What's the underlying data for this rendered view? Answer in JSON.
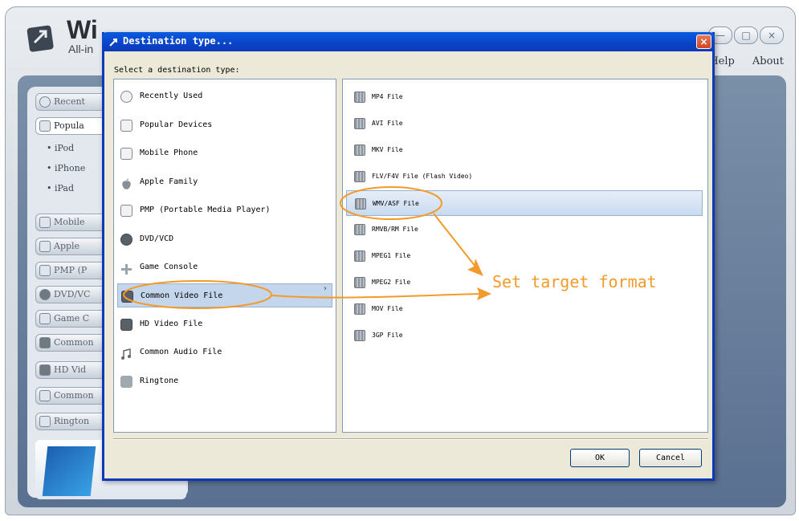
{
  "app": {
    "title": "Wi",
    "subtitle": "All-in",
    "menu": [
      "Help",
      "About"
    ],
    "window_controls": [
      "—",
      "□",
      "×"
    ],
    "sidebar_items": [
      "Recent",
      "Popula",
      "Mobile",
      "Apple",
      "PMP (P",
      "DVD/VC",
      "Game C",
      "Common",
      "HD Vid",
      "Common",
      "Rington"
    ],
    "popular_subitems": [
      "• iPod",
      "• iPhone",
      "• iPad"
    ]
  },
  "dialog": {
    "title": "Destination type...",
    "close_glyph": "×",
    "prompt": "Select a destination type:",
    "categories": [
      {
        "label": "Recently Used",
        "icon": "clock-icon"
      },
      {
        "label": "Popular Devices",
        "icon": "arrow-box-icon"
      },
      {
        "label": "Mobile Phone",
        "icon": "phone-icon"
      },
      {
        "label": "Apple Family",
        "icon": "apple-icon"
      },
      {
        "label": "PMP (Portable Media Player)",
        "icon": "player-icon"
      },
      {
        "label": "DVD/VCD",
        "icon": "disc-icon"
      },
      {
        "label": "Game Console",
        "icon": "gamepad-icon"
      },
      {
        "label": "Common Video File",
        "icon": "film-icon",
        "selected": true,
        "arrow": "›"
      },
      {
        "label": "HD Video File",
        "icon": "hd-icon"
      },
      {
        "label": "Common Audio File",
        "icon": "music-note-icon"
      },
      {
        "label": "Ringtone",
        "icon": "ringtone-icon"
      }
    ],
    "formats": [
      {
        "label": "MP4 File"
      },
      {
        "label": "AVI File"
      },
      {
        "label": "MKV File"
      },
      {
        "label": "FLV/F4V File (Flash Video)"
      },
      {
        "label": "WMV/ASF File",
        "selected": true
      },
      {
        "label": "RMVB/RM File"
      },
      {
        "label": "MPEG1 File"
      },
      {
        "label": "MPEG2 File"
      },
      {
        "label": "MOV File"
      },
      {
        "label": "3GP File"
      }
    ],
    "ok_label": "OK",
    "cancel_label": "Cancel"
  },
  "annotation": {
    "text": "Set target format",
    "color": "#f39a2a"
  }
}
